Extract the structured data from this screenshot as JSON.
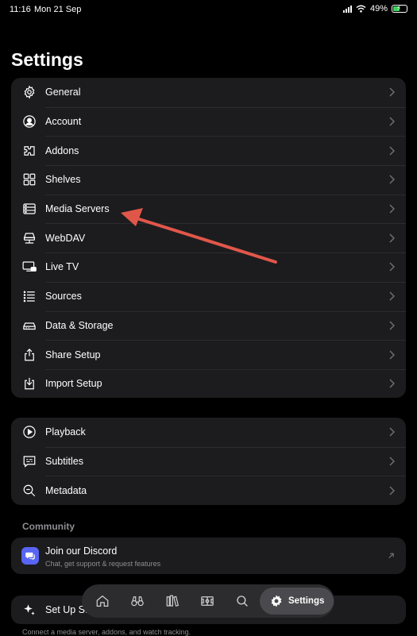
{
  "status_bar": {
    "time": "11:16",
    "date": "Mon 21 Sep",
    "battery": "49%",
    "battery_level": 0.49
  },
  "page_title": "Settings",
  "groups": [
    {
      "items": [
        {
          "label": "General",
          "icon": "gear-icon"
        },
        {
          "label": "Account",
          "icon": "person-circle-icon"
        },
        {
          "label": "Addons",
          "icon": "puzzle-icon"
        },
        {
          "label": "Shelves",
          "icon": "grid-icon"
        },
        {
          "label": "Media Servers",
          "icon": "server-icon"
        },
        {
          "label": "WebDAV",
          "icon": "network-drive-icon"
        },
        {
          "label": "Live TV",
          "icon": "tv-icon"
        },
        {
          "label": "Sources",
          "icon": "list-icon"
        },
        {
          "label": "Data & Storage",
          "icon": "drive-icon"
        },
        {
          "label": "Share Setup",
          "icon": "share-icon"
        },
        {
          "label": "Import Setup",
          "icon": "import-icon"
        }
      ]
    },
    {
      "items": [
        {
          "label": "Playback",
          "icon": "play-circle-icon"
        },
        {
          "label": "Subtitles",
          "icon": "subtitles-icon"
        },
        {
          "label": "Metadata",
          "icon": "magnifier-icon"
        }
      ]
    }
  ],
  "community": {
    "header": "Community",
    "discord_title": "Join our Discord",
    "discord_subtitle": "Chat, get support & request features"
  },
  "setup": {
    "label": "Set Up St",
    "hint": "Connect a media server, addons, and watch tracking."
  },
  "tab_bar": {
    "tabs": [
      {
        "icon": "home-icon"
      },
      {
        "icon": "binoculars-icon"
      },
      {
        "icon": "library-icon"
      },
      {
        "icon": "sports-field-icon"
      },
      {
        "icon": "search-icon"
      }
    ],
    "active_label": "Settings",
    "active_icon": "gear-icon"
  },
  "colors": {
    "background": "#000000",
    "card": "#1c1c1e",
    "separator": "#2c2c2e",
    "secondary_text": "#8e8e93",
    "arrow": "#e0574a",
    "discord": "#5865f2"
  }
}
